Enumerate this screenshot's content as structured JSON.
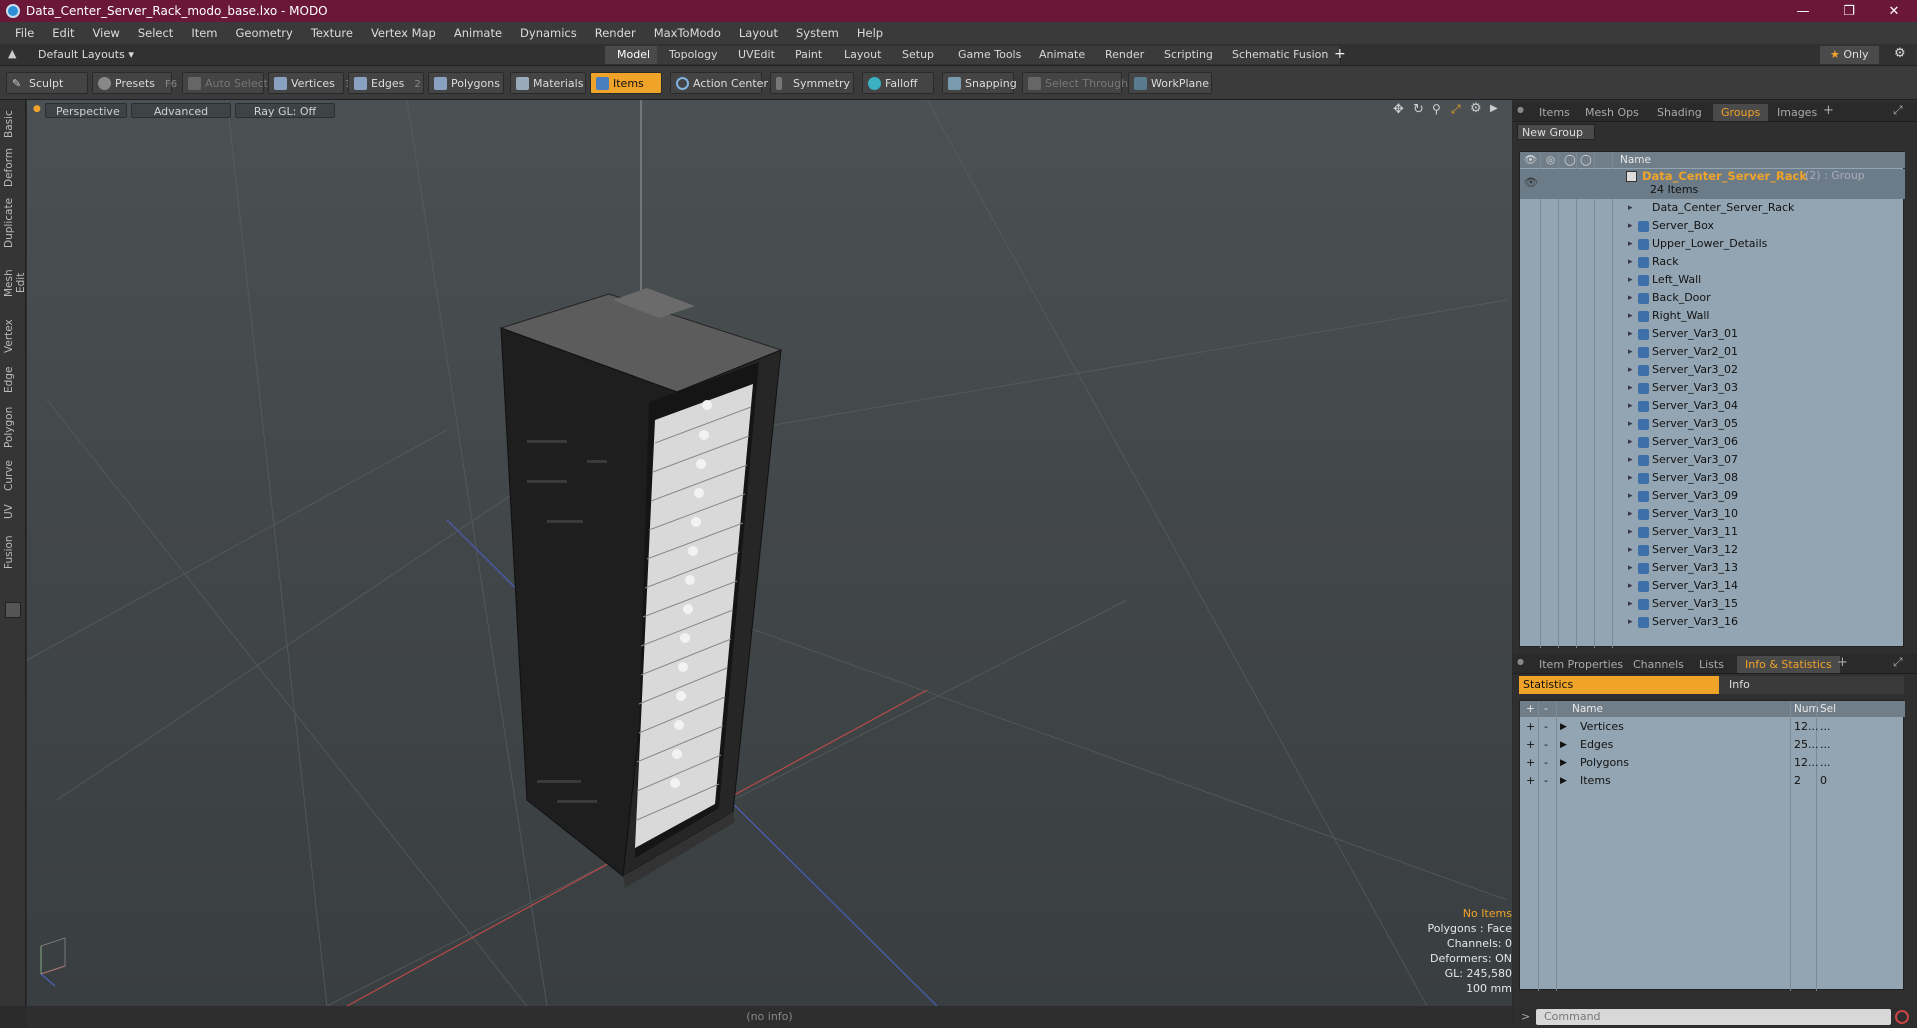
{
  "window": {
    "title": "Data_Center_Server_Rack_modo_base.lxo - MODO"
  },
  "menu": [
    "File",
    "Edit",
    "View",
    "Select",
    "Item",
    "Geometry",
    "Texture",
    "Vertex Map",
    "Animate",
    "Dynamics",
    "Render",
    "MaxToModo",
    "Layout",
    "System",
    "Help"
  ],
  "layouts": {
    "selector": "Default Layouts",
    "tabs": [
      "Model",
      "Topology",
      "UVEdit",
      "Paint",
      "Layout",
      "Setup",
      "Game Tools",
      "Animate",
      "Render",
      "Scripting",
      "Schematic Fusion"
    ],
    "active": "Model",
    "only_label": "Only"
  },
  "toolbar": {
    "sculpt": "Sculpt",
    "presets": "Presets",
    "presets_key": "F6",
    "auto_select": "Auto Select",
    "vertices": "Vertices",
    "vertices_key": "1",
    "edges": "Edges",
    "edges_key": "2",
    "polygons": "Polygons",
    "materials": "Materials",
    "items": "Items",
    "action_center": "Action Center",
    "symmetry": "Symmetry",
    "falloff": "Falloff",
    "snapping": "Snapping",
    "select_through": "Select Through",
    "workplane": "WorkPlane"
  },
  "left_tabs": [
    "Basic",
    "Deform",
    "Duplicate",
    "Mesh Edit",
    "Vertex",
    "Edge",
    "Polygon",
    "Curve",
    "UV",
    "Fusion"
  ],
  "viewport": {
    "projection": "Perspective",
    "advanced": "Advanced",
    "raygl": "Ray GL: Off",
    "hud": {
      "selection": "No Items",
      "polygons": "Polygons : Face",
      "channels": "Channels: 0",
      "deformers": "Deformers: ON",
      "gl": "GL: 245,580",
      "scale": "100 mm"
    }
  },
  "status": {
    "info": "(no info)"
  },
  "top_panel": {
    "tabs": [
      "Items",
      "Mesh Ops",
      "Shading",
      "Groups",
      "Images"
    ],
    "active": "Groups",
    "new_group": "New Group",
    "name_header": "Name",
    "group": {
      "name": "Data_Center_Server_Rack",
      "suffix": "(2) : Group",
      "count": "24 Items"
    },
    "items": [
      "Data_Center_Server_Rack",
      "Server_Box",
      "Upper_Lower_Details",
      "Rack",
      "Left_Wall",
      "Back_Door",
      "Right_Wall",
      "Server_Var3_01",
      "Server_Var2_01",
      "Server_Var3_02",
      "Server_Var3_03",
      "Server_Var3_04",
      "Server_Var3_05",
      "Server_Var3_06",
      "Server_Var3_07",
      "Server_Var3_08",
      "Server_Var3_09",
      "Server_Var3_10",
      "Server_Var3_11",
      "Server_Var3_12",
      "Server_Var3_13",
      "Server_Var3_14",
      "Server_Var3_15",
      "Server_Var3_16"
    ]
  },
  "bottom_panel": {
    "tabs": [
      "Item Properties",
      "Channels",
      "Lists",
      "Info & Statistics"
    ],
    "active": "Info & Statistics",
    "sub_tabs": [
      "Statistics",
      "Info"
    ],
    "headers": {
      "name": "Name",
      "num": "Num",
      "sel": "Sel"
    },
    "rows": [
      {
        "name": "Vertices",
        "num": "12...",
        "sel": "..."
      },
      {
        "name": "Edges",
        "num": "25...",
        "sel": "..."
      },
      {
        "name": "Polygons",
        "num": "12...",
        "sel": "..."
      },
      {
        "name": "Items",
        "num": "2",
        "sel": "0"
      }
    ]
  },
  "command": {
    "placeholder": "Command"
  },
  "colors": {
    "accent": "#f0a329",
    "titlebar": "#6b1738",
    "list_bg": "#93a5b2"
  }
}
